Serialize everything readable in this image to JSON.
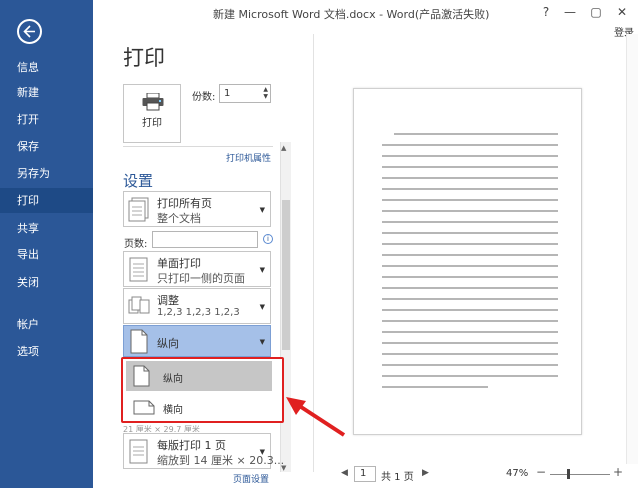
{
  "window": {
    "title": "新建 Microsoft Word 文档.docx - Word(产品激活失败)",
    "controls": [
      "?",
      "—",
      "▢",
      "✕"
    ],
    "login": "登录"
  },
  "nav": {
    "items": [
      {
        "label": "信息"
      },
      {
        "label": "新建"
      },
      {
        "label": "打开"
      },
      {
        "label": "保存"
      },
      {
        "label": "另存为"
      },
      {
        "label": "打印",
        "active": true
      },
      {
        "label": "共享"
      },
      {
        "label": "导出"
      },
      {
        "label": "关闭"
      },
      {
        "label": "帐户"
      },
      {
        "label": "选项"
      }
    ]
  },
  "print": {
    "title": "打印",
    "button_label": "打印",
    "copies_label": "份数:",
    "copies_value": "1",
    "printer_props": "打印机属性"
  },
  "settings": {
    "title": "设置",
    "print_range": {
      "line1": "打印所有页",
      "line2": "整个文档"
    },
    "pages_label": "页数:",
    "pages_value": "",
    "sides": {
      "line1": "单面打印",
      "line2": "只打印一侧的页面"
    },
    "collate": {
      "line1": "调整",
      "line2": "1,2,3    1,2,3    1,2,3"
    },
    "orientation": {
      "line1": "纵向"
    },
    "popup_options": [
      {
        "label": "纵向",
        "highlighted": true
      },
      {
        "label": "横向",
        "highlighted": false
      }
    ],
    "hidden_row": "21 厘米 × 29.7 厘米",
    "per_sheet": {
      "line1": "每版打印 1 页",
      "line2": "缩放到 14 厘米 × 20.3..."
    },
    "page_setup": "页面设置"
  },
  "preview": {
    "page_current": "1",
    "page_total": "共 1 页",
    "zoom": "47%"
  },
  "colors": {
    "nav_bg": "#2b5797",
    "accent": "#2b5797",
    "selection": "#a5c0e8",
    "annotation": "#e02020"
  }
}
